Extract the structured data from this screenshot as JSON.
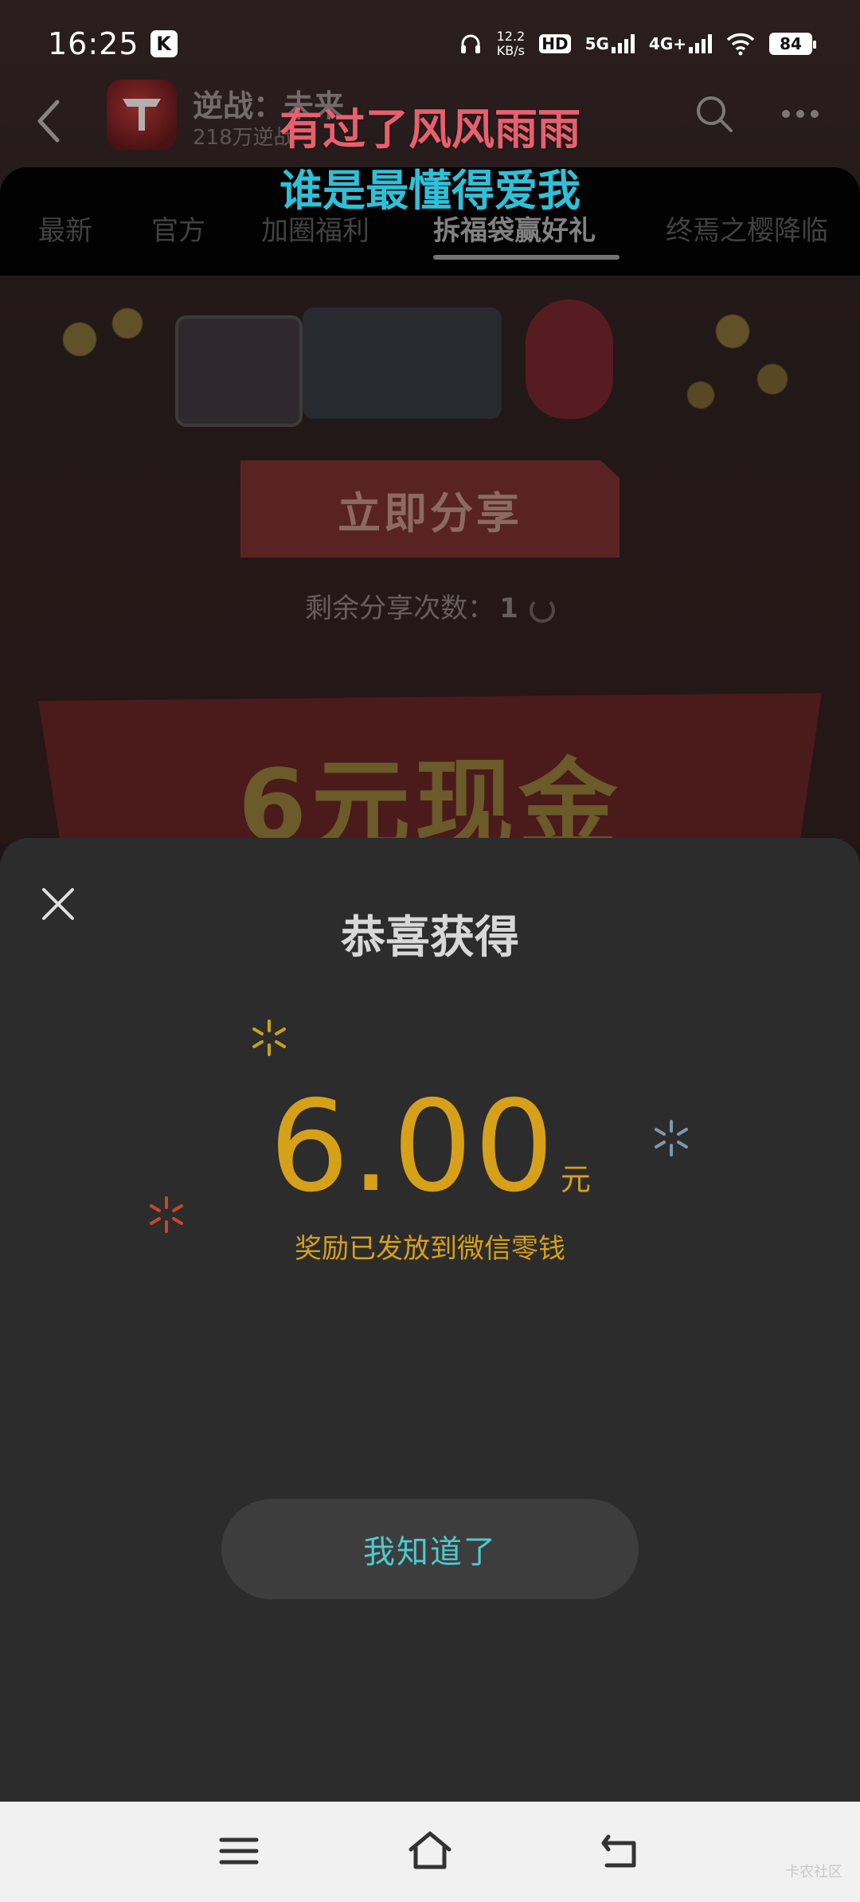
{
  "status_bar": {
    "time": "16:25",
    "app_badge": "K",
    "net_speed_value": "12.2",
    "net_speed_unit": "KB/s",
    "hd_label": "HD",
    "network_5g": "5G",
    "network_4g": "4G+",
    "battery": "84"
  },
  "header": {
    "game_name": "逆战：未来",
    "game_sub": "218万逆战"
  },
  "lyrics": {
    "line1": "有过了风风雨雨",
    "line2": "谁是最懂得爱我"
  },
  "tabs": [
    {
      "label": "最新",
      "active": false
    },
    {
      "label": "官方",
      "active": false
    },
    {
      "label": "加圈福利",
      "active": false
    },
    {
      "label": "拆福袋赢好礼",
      "active": true
    },
    {
      "label": "终焉之樱降临",
      "active": false
    }
  ],
  "promo": {
    "share_button": "立即分享",
    "share_remaining_label": "剩余分享次数：",
    "share_remaining_count": "1",
    "cash_banner": "6元现金"
  },
  "modal": {
    "title": "恭喜获得",
    "amount": "6.00",
    "unit": "元",
    "note": "奖励已发放到微信零钱",
    "confirm_button": "我知道了",
    "accent_color": "#d6a019",
    "button_text_color": "#4ec9cf"
  },
  "watermark": "卡农社区",
  "icons": {
    "close": "close-icon",
    "back": "back-icon",
    "search": "search-icon",
    "more": "more-icon",
    "nav_menu": "menu-icon",
    "nav_home": "home-icon",
    "nav_back": "back-arrow-icon"
  }
}
